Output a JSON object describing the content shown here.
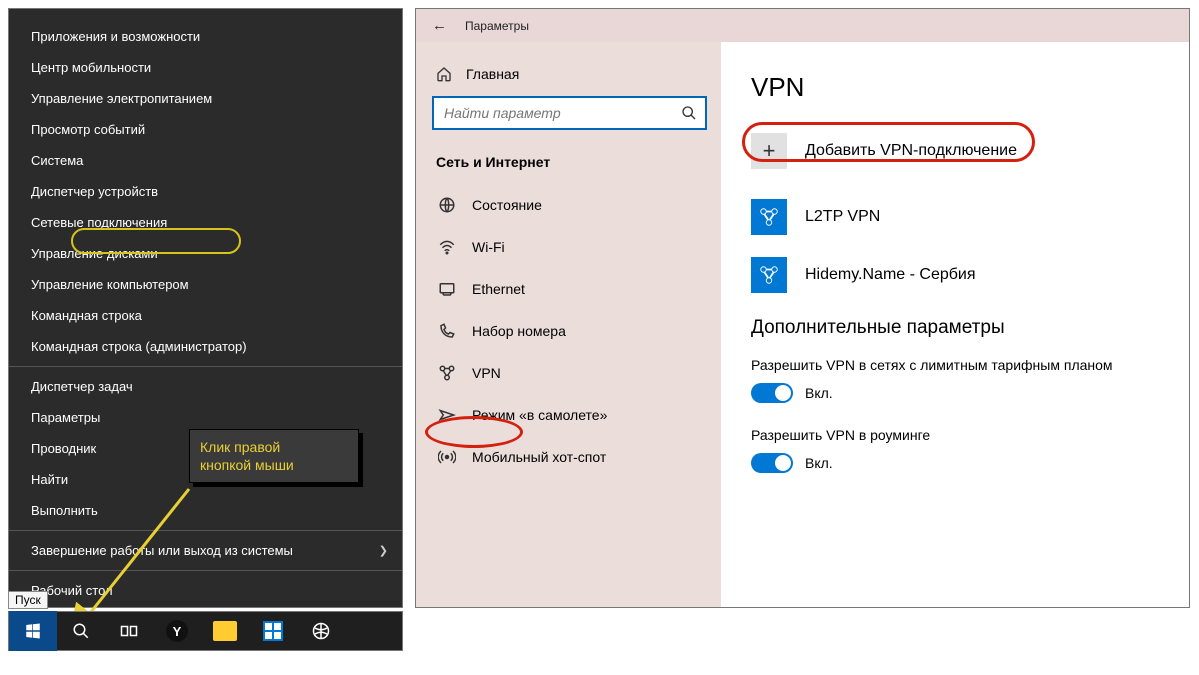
{
  "winx": {
    "items1": [
      "Приложения и возможности",
      "Центр мобильности",
      "Управление электропитанием",
      "Просмотр событий",
      "Система",
      "Диспетчер устройств",
      "Сетевые подключения",
      "Управление дисками",
      "Управление компьютером",
      "Командная строка",
      "Командная строка (администратор)"
    ],
    "items2": [
      "Диспетчер задач",
      "Параметры",
      "Проводник",
      "Найти",
      "Выполнить"
    ],
    "submenu": "Завершение работы или выход из системы",
    "desktop": "Рабочий стол"
  },
  "callout": {
    "line1": "Клик правой",
    "line2": "кнопкой мыши"
  },
  "taskbar": {
    "tooltip": "Пуск"
  },
  "titlebar": {
    "title": "Параметры"
  },
  "sidebar": {
    "home": "Главная",
    "search_placeholder": "Найти параметр",
    "category": "Сеть и Интернет",
    "items": [
      "Состояние",
      "Wi-Fi",
      "Ethernet",
      "Набор номера",
      "VPN",
      "Режим «в самолете»",
      "Мобильный хот-спот"
    ]
  },
  "content": {
    "heading": "VPN",
    "add_label": "Добавить VPN-подключение",
    "connections": [
      "L2TP VPN",
      "Hidemy.Name - Сербия"
    ],
    "extra_heading": "Дополнительные параметры",
    "opt1": "Разрешить VPN в сетях с лимитным тарифным планом",
    "opt2": "Разрешить VPN в роуминге",
    "toggle_state": "Вкл."
  }
}
